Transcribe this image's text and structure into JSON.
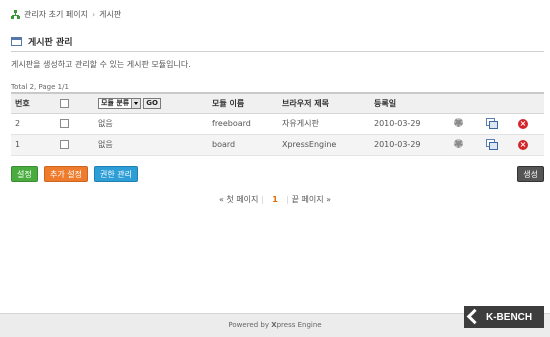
{
  "breadcrumb": {
    "home": "관리자 초기 페이지",
    "separator": "›",
    "current": "게시판"
  },
  "section": {
    "title": "게시판 관리",
    "description": "게시판을 생성하고 관리할 수 있는 게시판 모듈입니다."
  },
  "summary": "Total 2, Page 1/1",
  "table": {
    "headers": {
      "no": "번호",
      "category_select": "모듈 분류",
      "go": "GO",
      "module_name": "모듈 이름",
      "browser_title": "브라우저 제목",
      "regdate": "등록일"
    },
    "rows": [
      {
        "no": "2",
        "category": "없음",
        "module_name": "freeboard",
        "browser_title": "자유게시판",
        "regdate": "2010-03-29"
      },
      {
        "no": "1",
        "category": "없음",
        "module_name": "board",
        "browser_title": "XpressEngine",
        "regdate": "2010-03-29"
      }
    ]
  },
  "buttons": {
    "settings": "설정",
    "extra_settings": "추가 설정",
    "permission": "권한 관리",
    "create": "생성"
  },
  "pager": {
    "first": "« 첫 페이지",
    "current": "1",
    "last": "끝 페이지 »"
  },
  "footer": {
    "powered_prefix": "Powered by ",
    "powered_brand": "X",
    "powered_suffix": "press Engine"
  },
  "logo": {
    "text": "K-BENCH"
  },
  "colors": {
    "accent_green": "#4aac3f",
    "accent_orange": "#ee7c2c",
    "accent_blue": "#2e9ed6",
    "dark_button": "#555555",
    "delete_red": "#d2262b",
    "current_page": "#e06a00"
  },
  "icons": {
    "breadcrumb": "sitemap-icon",
    "section": "window-icon",
    "row_settings": "gear-icon",
    "row_copy": "copy-icon",
    "row_delete": "delete-icon"
  }
}
